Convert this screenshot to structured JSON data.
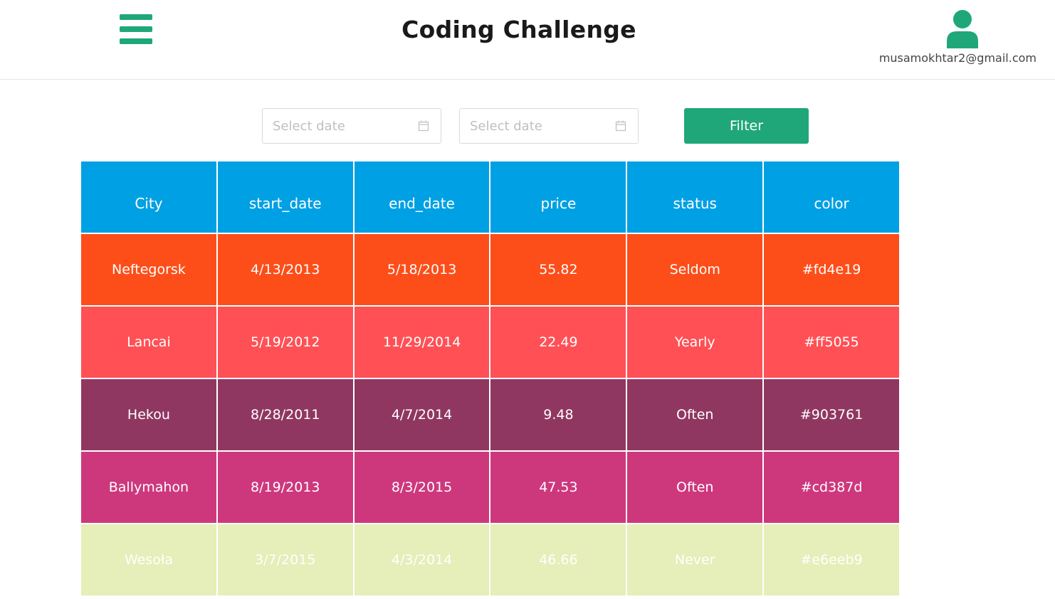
{
  "header": {
    "title": "Coding Challenge",
    "user_email": "musamokhtar2@gmail.com"
  },
  "icons": {
    "menu": "hamburger-menu-icon",
    "user": "user-avatar-icon",
    "calendar": "calendar-icon"
  },
  "filters": {
    "start_placeholder": "Select date",
    "end_placeholder": "Select date",
    "button_label": "Filter"
  },
  "colors": {
    "accent": "#1fa77a",
    "table_header": "#00a0e4"
  },
  "table": {
    "columns": [
      "City",
      "start_date",
      "end_date",
      "price",
      "status",
      "color"
    ],
    "rows": [
      {
        "cells": [
          "Neftegorsk",
          "4/13/2013",
          "5/18/2013",
          "55.82",
          "Seldom",
          "#fd4e19"
        ],
        "color": "#fd4e19"
      },
      {
        "cells": [
          "Lancai",
          "5/19/2012",
          "11/29/2014",
          "22.49",
          "Yearly",
          "#ff5055"
        ],
        "color": "#ff5055"
      },
      {
        "cells": [
          "Hekou",
          "8/28/2011",
          "4/7/2014",
          "9.48",
          "Often",
          "#903761"
        ],
        "color": "#903761"
      },
      {
        "cells": [
          "Ballymahon",
          "8/19/2013",
          "8/3/2015",
          "47.53",
          "Often",
          "#cd387d"
        ],
        "color": "#cd387d"
      },
      {
        "cells": [
          "Wesoła",
          "3/7/2015",
          "4/3/2014",
          "46.66",
          "Never",
          "#e6eeb9"
        ],
        "color": "#e6eeb9"
      }
    ]
  }
}
